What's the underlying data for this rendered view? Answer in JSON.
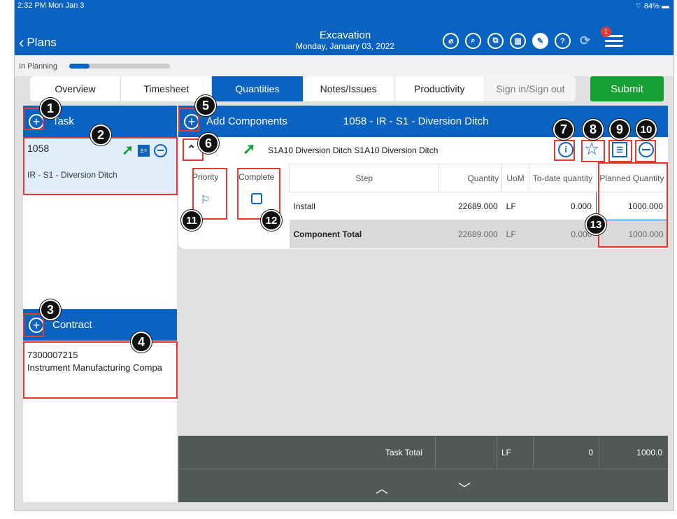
{
  "status": {
    "time": "2:32 PM  Mon Jan 3",
    "battery": "84%"
  },
  "header": {
    "back_label": "Plans",
    "title": "Excavation",
    "subtitle": "Monday, January 03, 2022",
    "notification_count": "1"
  },
  "phase": {
    "label": "In Planning",
    "progress": 0.2
  },
  "tabs": [
    {
      "label": "Overview"
    },
    {
      "label": "Timesheet"
    },
    {
      "label": "Quantities"
    },
    {
      "label": "Notes/Issues"
    },
    {
      "label": "Productivity"
    },
    {
      "label": "Sign in/Sign out"
    }
  ],
  "submit_label": "Submit",
  "task": {
    "header": "Task",
    "id": "1058",
    "description": "IR - S1 - Diversion Ditch"
  },
  "contract": {
    "header": "Contract",
    "number": "7300007215",
    "name": "Instrument Manufacturing Compa"
  },
  "components": {
    "header": "Add Components",
    "task_title": "1058 - IR - S1 - Diversion Ditch",
    "component_name": "S1A10 Diversion Ditch S1A10 Diversion Ditch",
    "priority_label": "Priority",
    "complete_label": "Complete",
    "columns": [
      "Step",
      "Quantity",
      "UoM",
      "To-date quantity",
      "Planned Quantity"
    ],
    "rows": [
      {
        "step": "Install",
        "quantity": "22689.000",
        "uom": "LF",
        "todate": "0.000",
        "planned": "1000.000"
      }
    ],
    "total": {
      "label": "Component Total",
      "quantity": "22689.000",
      "uom": "LF",
      "todate": "0.000",
      "planned": "1000.000"
    }
  },
  "task_total": {
    "label": "Task Total",
    "uom": "LF",
    "todate": "0",
    "planned": "1000.0"
  },
  "badges": [
    "1",
    "2",
    "3",
    "4",
    "5",
    "6",
    "7",
    "8",
    "9",
    "10",
    "11",
    "12",
    "13"
  ],
  "colors": {
    "primary": "#0b63c1",
    "submit": "#16a034",
    "highlight": "#e53935"
  }
}
